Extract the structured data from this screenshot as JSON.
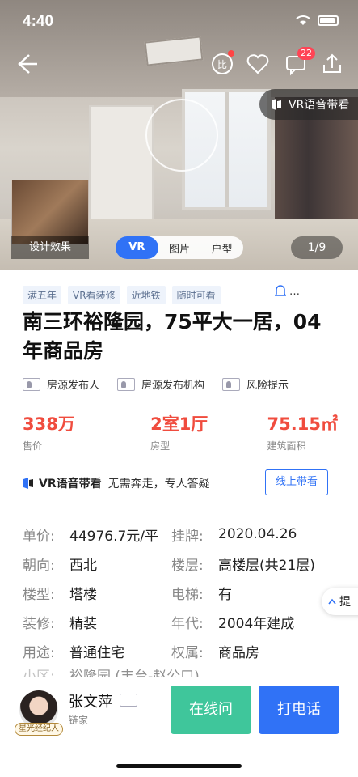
{
  "status_bar": {
    "time": "4:40"
  },
  "top_bar": {
    "message_badge": "22"
  },
  "hero": {
    "vr_voice_label": "VR语音带看",
    "design_effect_label": "设计效果",
    "media_tabs": [
      "VR",
      "图片",
      "户型"
    ],
    "active_tab": "VR",
    "page_indicator": "1/9"
  },
  "tags": [
    "满五年",
    "VR看装修",
    "近地铁",
    "随时可看"
  ],
  "more_label": "…",
  "title": "南三环裕隆园，75平大一居，04年商品房",
  "roles": [
    "房源发布人",
    "房源发布机构",
    "风险提示"
  ],
  "stats": [
    {
      "value": "338万",
      "label": "售价"
    },
    {
      "value": "2室1厅",
      "label": "房型"
    },
    {
      "value": "75.15㎡",
      "label": "建筑面积"
    }
  ],
  "vr_banner": {
    "label": "VR语音带看",
    "desc": "无需奔走，专人答疑",
    "button": "线上带看"
  },
  "info": [
    {
      "k1": "单价:",
      "v1": "44976.7元/平",
      "k2": "挂牌:",
      "v2": "2020.04.26"
    },
    {
      "k1": "朝向:",
      "v1": "西北",
      "k2": "楼层:",
      "v2": "高楼层(共21层)"
    },
    {
      "k1": "楼型:",
      "v1": "塔楼",
      "k2": "电梯:",
      "v2": "有"
    },
    {
      "k1": "装修:",
      "v1": "精装",
      "k2": "年代:",
      "v2": "2004年建成"
    },
    {
      "k1": "用途:",
      "v1": "普通住宅",
      "k2": "权属:",
      "v2": "商品房"
    },
    {
      "k1": "小区:",
      "v1": "裕隆园 (丰台-赵公口)",
      "k2": "",
      "v2": ""
    }
  ],
  "float_tip": "提",
  "agent": {
    "name": "张文萍",
    "company": "链家",
    "badge": "星光经纪人"
  },
  "actions": {
    "chat": "在线问",
    "call": "打电话"
  }
}
